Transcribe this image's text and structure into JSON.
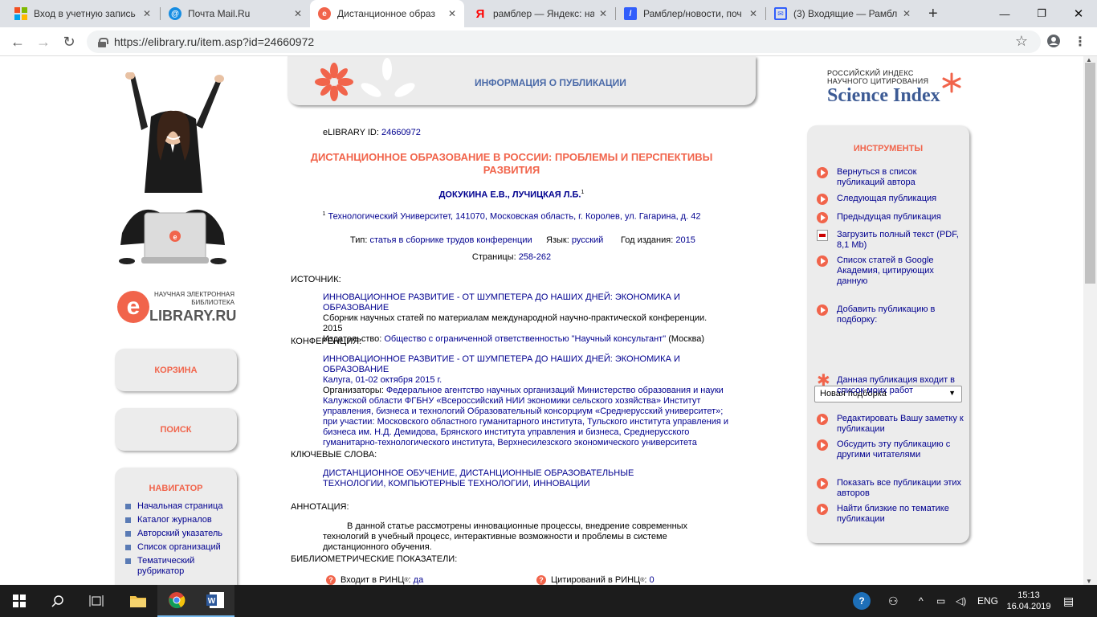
{
  "browser": {
    "tabs": [
      {
        "title": "Вход в учетную запись",
        "icon": "microsoft-icon",
        "color": "#f25022"
      },
      {
        "title": "Почта Mail.Ru",
        "icon": "mailru-icon",
        "color": "#168de2"
      },
      {
        "title": "Дистанционное образ",
        "icon": "elibrary-icon",
        "color": "#f1644b"
      },
      {
        "title": "рамблер — Яндекс: на",
        "icon": "yandex-icon",
        "color": "#ff0000"
      },
      {
        "title": "Рамблер/новости, поч",
        "icon": "rambler-icon",
        "color": "#315efb"
      },
      {
        "title": "(3) Входящие — Рамбл",
        "icon": "rambler-mail-icon",
        "color": "#315efb"
      }
    ],
    "url": "https://elibrary.ru/item.asp?id=24660972"
  },
  "header": {
    "title": "ИНФОРМАЦИЯ О ПУБЛИКАЦИИ"
  },
  "logo": {
    "small": "НАУЧНАЯ ЭЛЕКТРОННАЯ БИБЛИОТЕКА",
    "big": "LIBRARY.RU",
    "e": "e"
  },
  "left_panels": {
    "cart": "КОРЗИНА",
    "search": "ПОИСК",
    "navigator": {
      "title": "НАВИГАТОР",
      "items": [
        "Начальная страница",
        "Каталог журналов",
        "Авторский указатель",
        "Список организаций",
        "Тематический рубрикатор"
      ]
    }
  },
  "publication": {
    "id_label": "eLIBRARY ID:",
    "id": "24660972",
    "title": "ДИСТАНЦИОННОЕ ОБРАЗОВАНИЕ В РОССИИ: ПРОБЛЕМЫ И ПЕРСПЕКТИВЫ РАЗВИТИЯ",
    "authors": "ДОКУКИНА Е.В., ЛУЧИЦКАЯ Л.Б.",
    "authors_sup": "1",
    "affiliation_sup": "1",
    "affiliation": "Технологический Университет, 141070, Московская область, г. Королев, ул. Гагарина, д. 42",
    "type_label": "Тип:",
    "type": "статья в сборнике трудов конференции",
    "lang_label": "Язык:",
    "lang": "русский",
    "year_label": "Год издания:",
    "year": "2015",
    "pages_label": "Страницы:",
    "pages": "258-262"
  },
  "source": {
    "label": "ИСТОЧНИК:",
    "title": "ИННОВАЦИОННОЕ РАЗВИТИЕ - ОТ ШУМПЕТЕРА ДО НАШИХ ДНЕЙ: ЭКОНОМИКА И ОБРАЗОВАНИЕ",
    "subtitle": "Сборник научных статей по материалам международной научно-практической конференции. 2015",
    "publisher_label": "Издательство:",
    "publisher": "Общество с ограниченной ответственностью \"Научный консультант\"",
    "city": "(Москва)"
  },
  "conference": {
    "label": "КОНФЕРЕНЦИЯ:",
    "title": "ИННОВАЦИОННОЕ РАЗВИТИЕ - ОТ ШУМПЕТЕРА ДО НАШИХ ДНЕЙ: ЭКОНОМИКА И ОБРАЗОВАНИЕ",
    "place": "Калуга, 01-02 октября 2015 г.",
    "org_label": "Организаторы:",
    "orgs": "Федеральное агентство научных организаций Министерство образования и науки Калужской области ФГБНУ «Всероссийский НИИ экономики сельского хозяйства» Институт управления, бизнеса и технологий Образовательный консорциум «Среднерусский университет»; при участии: Московского областного гуманитарного института, Тульского института управления и бизнеса им. Н.Д. Демидова, Брянского института управления и бизнеса, Среднерусского гуманитарно-технологического института, Верхнесилезского экономического университета"
  },
  "keywords": {
    "label": "КЛЮЧЕВЫЕ СЛОВА:",
    "text": "ДИСТАНЦИОННОЕ ОБУЧЕНИЕ, ДИСТАНЦИОННЫЕ ОБРАЗОВАТЕЛЬНЫЕ ТЕХНОЛОГИИ, КОМПЬЮТЕРНЫЕ ТЕХНОЛОГИИ, ИННОВАЦИИ"
  },
  "annotation": {
    "label": "АННОТАЦИЯ:",
    "text": "В данной статье рассмотрены инновационные процессы, внедрение современных технологий в учебный процесс, интерактивные возможности и проблемы в системе дистанционного обучения."
  },
  "biblio": {
    "label": "БИБЛИОМЕТРИЧЕСКИЕ ПОКАЗАТЕЛИ:",
    "rinc_label": "Входит в РИНЦ",
    "rinc_sup": "®",
    "rinc_value": "да",
    "cit_label": "Цитирований в РИНЦ",
    "cit_sup": "®",
    "cit_value": "0"
  },
  "science_index": {
    "small1": "РОССИЙСКИЙ ИНДЕКС",
    "small2": "НАУЧНОГО ЦИТИРОВАНИЯ",
    "big": "Science Index"
  },
  "tools": {
    "title": "ИНСТРУМЕНТЫ",
    "items": [
      "Вернуться в список публикаций автора",
      "Следующая публикация",
      "Предыдущая публикация",
      "Загрузить полный текст (PDF, 8,1 Mb)",
      "Список статей в Google Академия, цитирующих данную",
      "Добавить публикацию в подборку:",
      "Данная публикация входит в список моих работ",
      "Редактировать Вашу заметку к публикации",
      "Обсудить эту публикацию с другими читателями",
      "Показать все публикации этих авторов",
      "Найти близкие по тематике публикации"
    ],
    "select_value": "Новая подборка"
  },
  "taskbar": {
    "lang": "ENG",
    "time": "15:13",
    "date": "16.04.2019"
  }
}
